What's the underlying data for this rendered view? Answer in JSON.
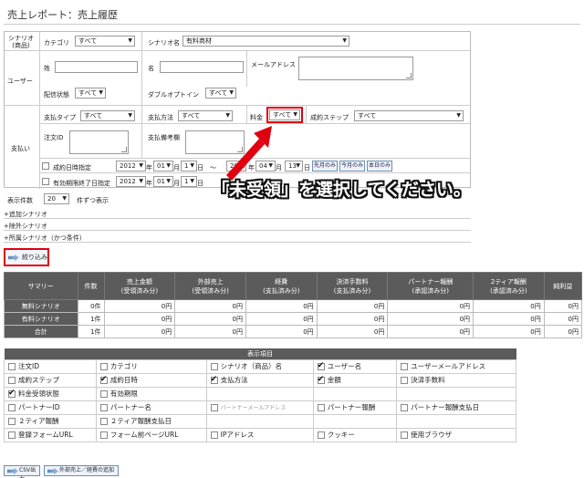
{
  "page": {
    "title": "売上レポート：売上履歴"
  },
  "form": {
    "scenario_label": "シナリオ\n(商品)",
    "category_label": "カテゴリ",
    "category_value": "すべて",
    "scenario_name_label": "シナリオ名",
    "scenario_name_value": "有料商材",
    "user_label": "ユーザー",
    "last_name_label": "姓",
    "first_name_label": "名",
    "email_label": "メールアドレス",
    "delivery_label": "配信状態",
    "delivery_value": "すべて",
    "double_optin_label": "ダブルオプトイン",
    "double_optin_value": "すべて",
    "payment_label": "支払い",
    "pay_type_label": "支払タイプ",
    "pay_type_value": "すべて",
    "pay_method_label": "支払方法",
    "pay_method_value": "すべて",
    "fee_label": "料金",
    "fee_value": "すべて",
    "success_step_label": "成約ステップ",
    "success_step_value": "すべて",
    "order_id_label": "注文ID",
    "pay_memo_label": "支払備考欄",
    "date_label": "成約日時指定",
    "expire_label": "有効期限終了日指定",
    "year1": "2012",
    "month1": "01",
    "day1": "1",
    "year2": "2017",
    "month2": "04",
    "day2": "13",
    "year_unit": "年",
    "month_unit": "月",
    "day_unit": "日",
    "tilde": "～",
    "last_month": "先月のみ",
    "this_month": "今月のみ",
    "today": "本日のみ",
    "display_count_label": "表示件数",
    "display_count_value": "20",
    "display_count_suffix": "件ずつ表示"
  },
  "accordions": [
    "+追加シナリオ",
    "+除外シナリオ",
    "+所属シナリオ（かつ条件）"
  ],
  "narrow_button": "絞り込み",
  "summary": {
    "headers": [
      "サマリー",
      "件数",
      "売上金額\n(受領済み分)",
      "外部売上\n(受領済み分)",
      "経費\n(支払済み分)",
      "決済手数料\n(支払済み分)",
      "パートナー報酬\n(承認済み分)",
      "2ティア報酬\n(承認済み分)",
      "純利益"
    ],
    "rows": [
      {
        "label": "無料シナリオ",
        "cells": [
          "0件",
          "0円",
          "0円",
          "0円",
          "0円",
          "0円",
          "0円",
          "0円"
        ]
      },
      {
        "label": "有料シナリオ",
        "cells": [
          "1件",
          "0円",
          "0円",
          "0円",
          "0円",
          "0円",
          "0円",
          "0円"
        ]
      },
      {
        "label": "合計",
        "cells": [
          "1件",
          "0円",
          "0円",
          "0円",
          "0円",
          "0円",
          "0円",
          "0円"
        ]
      }
    ]
  },
  "columns": {
    "title": "表示項目",
    "rows": [
      [
        {
          "t": "注文ID",
          "c": false
        },
        {
          "t": "カテゴリ",
          "c": false
        },
        {
          "t": "シナリオ（商品）名",
          "c": false
        },
        {
          "t": "ユーザー名",
          "c": true
        },
        {
          "t": "ユーザーメールアドレス",
          "c": false
        }
      ],
      [
        {
          "t": "成約ステップ",
          "c": false
        },
        {
          "t": "成約日時",
          "c": true
        },
        {
          "t": "支払方法",
          "c": true
        },
        {
          "t": "金額",
          "c": true
        },
        {
          "t": "決済手数料",
          "c": false
        }
      ],
      [
        {
          "t": "料金受領状態",
          "c": true
        },
        {
          "t": "有効期限",
          "c": false
        },
        {
          "t": "",
          "c": null
        },
        {
          "t": "",
          "c": null
        },
        {
          "t": "",
          "c": null
        }
      ],
      [
        {
          "t": "パートナーID",
          "c": false
        },
        {
          "t": "パートナー名",
          "c": false
        },
        {
          "t": "パートナーメールアドレス",
          "c": false,
          "dim": true
        },
        {
          "t": "パートナー報酬",
          "c": false
        },
        {
          "t": "パートナー報酬支払日",
          "c": false
        }
      ],
      [
        {
          "t": "２ティア報酬",
          "c": false
        },
        {
          "t": "２ティア報酬支払日",
          "c": false
        },
        {
          "t": "",
          "c": null
        },
        {
          "t": "",
          "c": null
        },
        {
          "t": "",
          "c": null
        }
      ],
      [
        {
          "t": "登録フォームURL",
          "c": false
        },
        {
          "t": "フォーム前ページURL",
          "c": false
        },
        {
          "t": "IPアドレス",
          "c": false
        },
        {
          "t": "クッキー",
          "c": false
        },
        {
          "t": "使用ブラウザ",
          "c": false
        }
      ]
    ]
  },
  "footer": {
    "csv_button": "CSV出力",
    "external_button": "外部売上／経費の追加"
  },
  "annotation": {
    "callout": "「未受領」を選択してください。"
  },
  "colors": {
    "header_gray": "#5b5b5b",
    "highlight_red": "#e00010",
    "button_blue": "#6a8fb5"
  }
}
